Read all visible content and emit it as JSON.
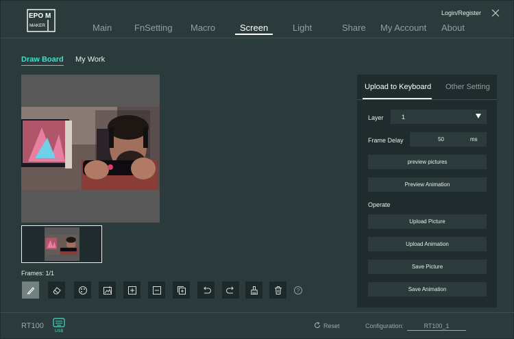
{
  "header": {
    "logo_text": "EPOMAKER",
    "login_label": "Login/Register",
    "close_icon": "close-icon"
  },
  "nav": {
    "items": [
      {
        "label": "Main"
      },
      {
        "label": "FnSetting"
      },
      {
        "label": "Macro"
      },
      {
        "label": "Screen",
        "active": true
      },
      {
        "label": "Light"
      },
      {
        "label": "Share"
      },
      {
        "label": "My Account"
      },
      {
        "label": "About"
      }
    ]
  },
  "subtabs": {
    "draw_board": "Draw Board",
    "my_work": "My Work",
    "active": "Draw Board"
  },
  "canvas": {
    "frames_label": "Frames: 1/1"
  },
  "tools": [
    {
      "icon": "brush-icon",
      "active": true
    },
    {
      "icon": "eraser-icon"
    },
    {
      "icon": "palette-icon"
    },
    {
      "icon": "image-import-icon"
    },
    {
      "icon": "add-frame-icon"
    },
    {
      "icon": "remove-frame-icon"
    },
    {
      "icon": "copy-frame-icon"
    },
    {
      "icon": "undo-icon"
    },
    {
      "icon": "redo-icon"
    },
    {
      "icon": "clear-brush-icon"
    },
    {
      "icon": "trash-icon"
    },
    {
      "icon": "help-icon"
    }
  ],
  "panel": {
    "tab_upload": "Upload to Keyboard",
    "tab_other": "Other Setting",
    "layer_label": "Layer",
    "layer_value": "1",
    "frame_delay_label": "Frame Delay",
    "frame_delay_value": "50",
    "frame_delay_unit": "ms",
    "preview_pictures": "preview pictures",
    "preview_animation": "Preview Animation",
    "operate_label": "Operate",
    "upload_picture": "Upload Picture",
    "upload_animation": "Upload Animation",
    "save_picture": "Save Picture",
    "save_animation": "Save Animation"
  },
  "footer": {
    "model": "RT100",
    "usb_label": "USB",
    "reset_label": "Reset",
    "configuration_label": "Configuration:",
    "configuration_value": "RT100_1"
  },
  "colors": {
    "background": "#2b3b3c",
    "panel": "#1f2b2c",
    "accent": "#3ee1c8",
    "canvas_gray": "#585858"
  }
}
